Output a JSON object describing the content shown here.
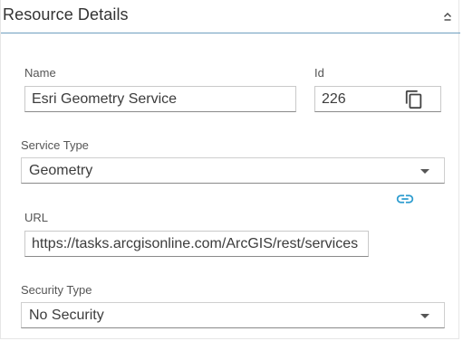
{
  "header": {
    "title": "Resource Details",
    "collapse_icon": "chevron-up-icon"
  },
  "fields": {
    "name": {
      "label": "Name",
      "value": "Esri Geometry Service"
    },
    "id": {
      "label": "Id",
      "value": "226",
      "action_icon": "copy-icon"
    },
    "service_type": {
      "label": "Service Type",
      "selected": "Geometry",
      "icon": "dropdown-arrow-icon"
    },
    "url": {
      "label": "URL",
      "value": "https://tasks.arcgisonline.com/ArcGIS/rest/services",
      "action_icon": "link-icon"
    },
    "security_type": {
      "label": "Security Type",
      "selected": "No Security",
      "icon": "dropdown-arrow-icon"
    }
  },
  "colors": {
    "accent": "#2d9ccf",
    "header_divider": "#6e9fbf",
    "text": "#333333"
  }
}
